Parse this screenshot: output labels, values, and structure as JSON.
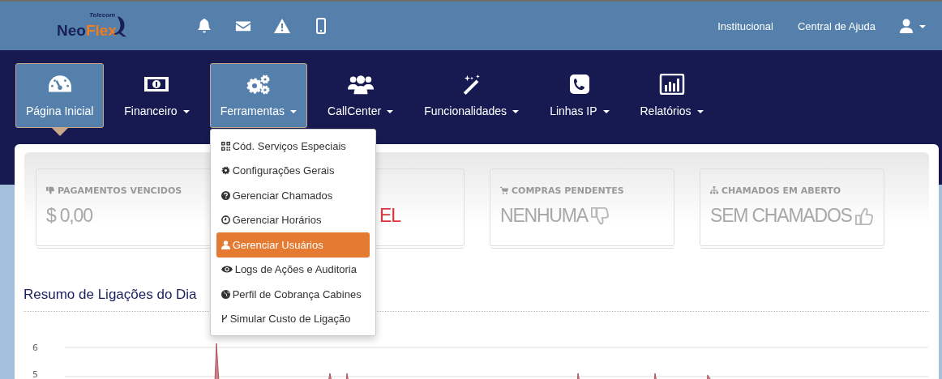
{
  "logo": {
    "small": "Telecom",
    "part1": "Neo",
    "part2": "Flex"
  },
  "top_icons": [
    {
      "kind": "bell"
    },
    {
      "kind": "mail"
    },
    {
      "kind": "warning"
    },
    {
      "kind": "mobile"
    }
  ],
  "top_links": [
    "Institucional",
    "Central de Ajuda"
  ],
  "nav": [
    {
      "label": "Página Inicial",
      "kind": "gauge",
      "caret": false,
      "selected": true,
      "open": false
    },
    {
      "label": "Financeiro",
      "kind": "money",
      "caret": true,
      "selected": false,
      "open": false
    },
    {
      "label": "Ferramentas",
      "kind": "gears",
      "caret": true,
      "selected": false,
      "open": true
    },
    {
      "label": "CallCenter",
      "kind": "users",
      "caret": true,
      "selected": false,
      "open": false
    },
    {
      "label": "Funcionalidades",
      "kind": "wand",
      "caret": true,
      "selected": false,
      "open": false
    },
    {
      "label": "Linhas IP",
      "kind": "phone",
      "caret": true,
      "selected": false,
      "open": false
    },
    {
      "label": "Relatórios",
      "kind": "chart",
      "caret": true,
      "selected": false,
      "open": false
    }
  ],
  "dropdown": [
    {
      "label": "Cód. Serviços Especiais",
      "kind": "qrcode",
      "selected": false
    },
    {
      "label": "Configurações Gerais",
      "kind": "gear",
      "selected": false
    },
    {
      "label": "Gerenciar Chamados",
      "kind": "question",
      "selected": false
    },
    {
      "label": "Gerenciar Horários",
      "kind": "clock",
      "selected": false
    },
    {
      "label": "Gerenciar Usuários",
      "kind": "user",
      "selected": true
    },
    {
      "label": "Logs de Ações e Auditoria",
      "kind": "eye",
      "selected": false
    },
    {
      "label": "Perfil de Cobrança Cabines",
      "kind": "globe",
      "selected": false
    },
    {
      "label": "Simular Custo de Ligação",
      "kind": "fork",
      "selected": false
    }
  ],
  "cards": [
    {
      "kind": "payments",
      "label": "PAGAMENTOS VENCIDOS",
      "value": "$ 0,00",
      "alert": false
    },
    {
      "kind": "hidden",
      "value": "EL",
      "alert": true
    },
    {
      "kind": "purchases",
      "label": "COMPRAS PENDENTES",
      "value": "NENHUMA",
      "alert": false
    },
    {
      "kind": "tickets",
      "label": "CHAMADOS EM ABERTO",
      "value": "SEM CHAMADOS",
      "alert": false
    }
  ],
  "chart": {
    "title": "Resumo de Ligações do Dia",
    "axis_labels": [
      "6",
      "5"
    ]
  }
}
